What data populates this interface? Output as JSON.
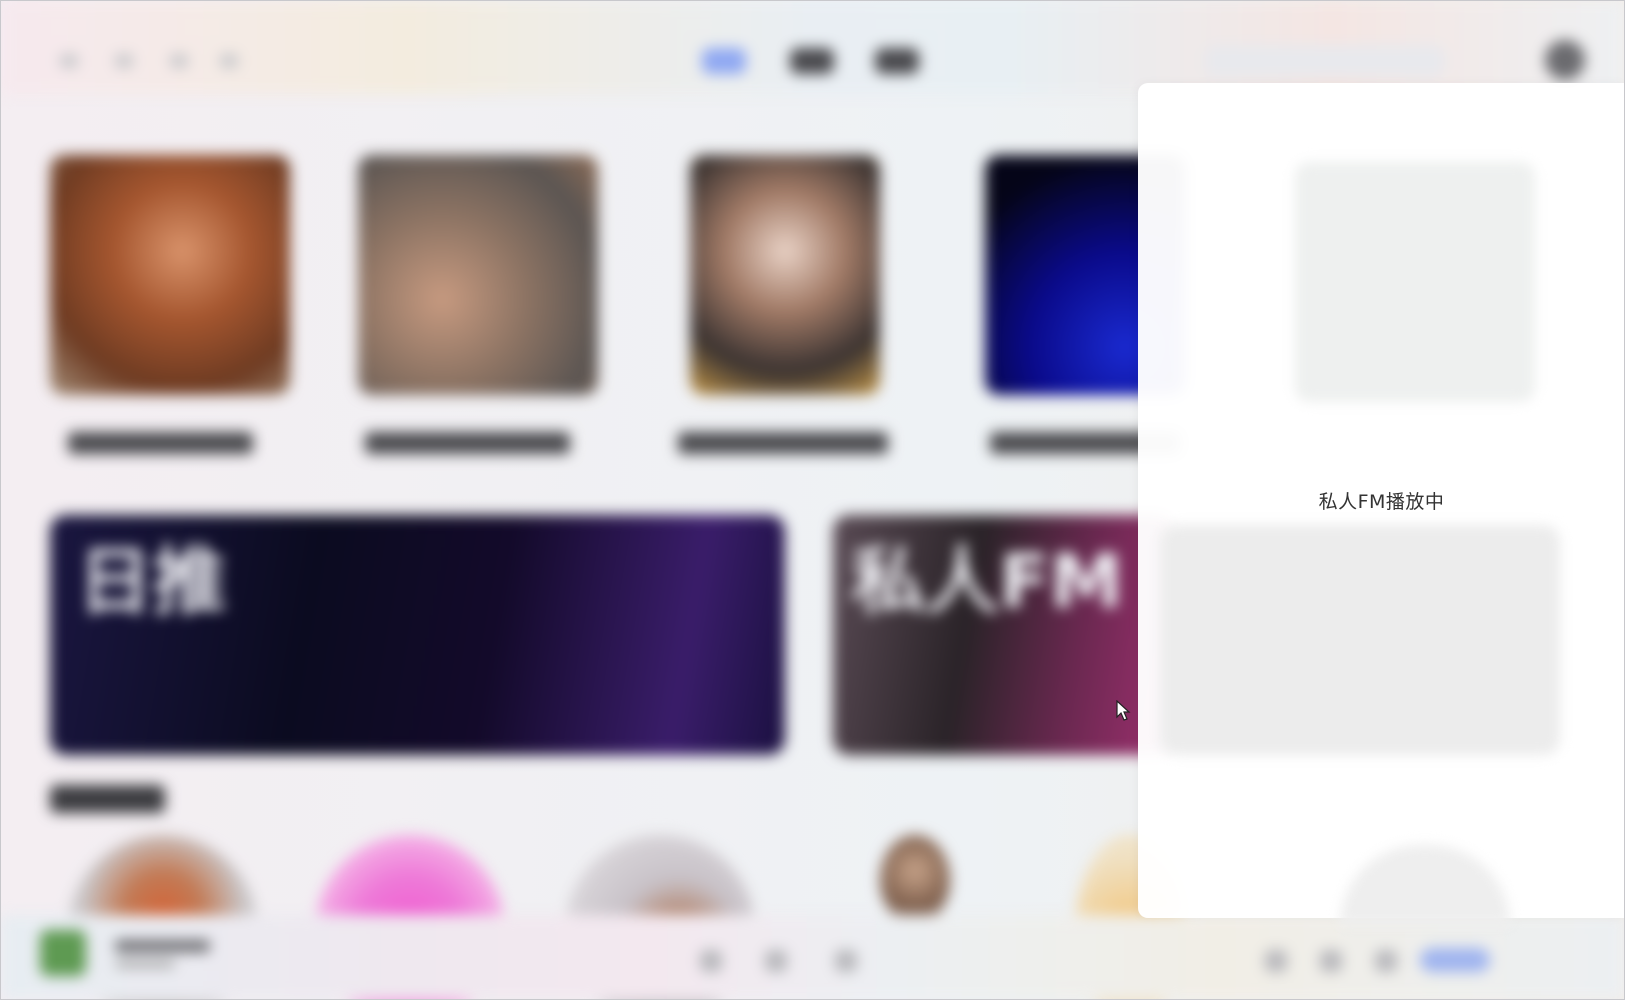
{
  "app": {
    "status_text": "私人FM播放中"
  },
  "topbar": {
    "tabs": [
      "",
      "",
      ""
    ],
    "icons": [
      "back-icon",
      "forward-icon",
      "refresh-icon",
      "home-icon",
      "search-icon",
      "avatar"
    ]
  },
  "sections": {
    "artists_count": 5,
    "banners": [
      "日推",
      "私人FM"
    ]
  },
  "colors": {
    "active_tab": "#8fa8f2",
    "panel_bg": "#ffffff",
    "status_text": "#333333"
  }
}
